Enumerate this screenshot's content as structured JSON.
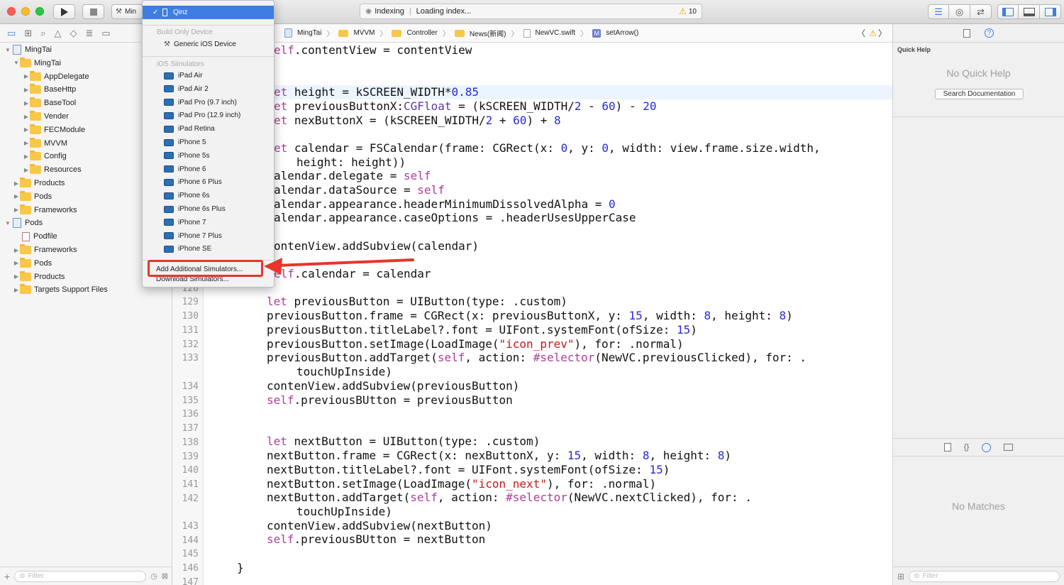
{
  "toolbar": {
    "scheme_label": "Min",
    "activity_status": "Indexing",
    "activity_sep": "|",
    "activity_detail": "Loading index...",
    "warning_count": "10"
  },
  "navigator": {
    "items": [
      {
        "label": "MingTai",
        "type": "project",
        "disclosure": "▼"
      },
      {
        "label": "MingTai",
        "type": "folder",
        "disclosure": "▼"
      },
      {
        "label": "AppDelegate",
        "type": "folder",
        "disclosure": "▶"
      },
      {
        "label": "BaseHttp",
        "type": "folder",
        "disclosure": "▶"
      },
      {
        "label": "BaseTool",
        "type": "folder",
        "disclosure": "▶"
      },
      {
        "label": "Vender",
        "type": "folder",
        "disclosure": "▶"
      },
      {
        "label": "FECModule",
        "type": "folder",
        "disclosure": "▶"
      },
      {
        "label": "MVVM",
        "type": "folder",
        "disclosure": "▶"
      },
      {
        "label": "Config",
        "type": "folder",
        "disclosure": "▶"
      },
      {
        "label": "Resources",
        "type": "folder",
        "disclosure": "▶"
      },
      {
        "label": "Products",
        "type": "folder",
        "disclosure": "▶"
      },
      {
        "label": "Pods",
        "type": "folder",
        "disclosure": "▶"
      },
      {
        "label": "Frameworks",
        "type": "folder",
        "disclosure": "▶"
      },
      {
        "label": "Pods",
        "type": "project",
        "disclosure": "▼"
      },
      {
        "label": "Podfile",
        "type": "file",
        "disclosure": ""
      },
      {
        "label": "Frameworks",
        "type": "folder",
        "disclosure": "▶"
      },
      {
        "label": "Pods",
        "type": "folder",
        "disclosure": "▶"
      },
      {
        "label": "Products",
        "type": "folder",
        "disclosure": "▶"
      },
      {
        "label": "Targets Support Files",
        "type": "folder",
        "disclosure": "▶"
      }
    ],
    "filter_placeholder": "Filter"
  },
  "jumpbar": {
    "crumbs": [
      "MingTai",
      "MVVM",
      "Controller",
      "News(新闻)",
      "NewVC.swift"
    ],
    "method_badge": "M",
    "method": "setArrow()"
  },
  "popup": {
    "selected_device": "Qinz",
    "section_build_only": "Build Only Device",
    "generic_device": "Generic iOS Device",
    "section_simulators": "iOS Simulators",
    "simulators": [
      "iPad Air",
      "iPad Air 2",
      "iPad Pro (9.7 inch)",
      "iPad Pro (12.9 inch)",
      "iPad Retina",
      "iPhone 5",
      "iPhone 5s",
      "iPhone 6",
      "iPhone 6 Plus",
      "iPhone 6s",
      "iPhone 6s Plus",
      "iPhone 7",
      "iPhone 7 Plus",
      "iPhone SE"
    ],
    "add_simulators": "Add Additional Simulators...",
    "download_simulators": "Download Simulators..."
  },
  "editor": {
    "line_numbers": [
      "128",
      "129",
      "130",
      "131",
      "132",
      "133",
      "",
      "134",
      "135",
      "136",
      "137",
      "138",
      "139",
      "140",
      "141",
      "142",
      "",
      "143",
      "144",
      "145",
      "146",
      "147"
    ]
  },
  "quick_help": {
    "title": "Quick Help",
    "empty": "No Quick Help",
    "search_button": "Search Documentation"
  },
  "library": {
    "empty": "No Matches",
    "filter_placeholder": "Filter"
  },
  "colors": {
    "annotation_red": "#e8352b",
    "selection_blue": "#3d7ee0"
  }
}
